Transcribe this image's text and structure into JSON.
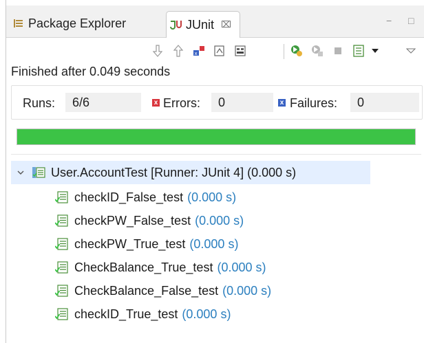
{
  "tabs": [
    {
      "label": "Package Explorer",
      "icon": "package-explorer-icon",
      "active": false
    },
    {
      "label": "JUnit",
      "icon": "junit-icon",
      "active": true,
      "close_glyph": "⌧"
    }
  ],
  "window_controls": {
    "minimize": "−",
    "maximize": "□"
  },
  "toolbar_icons": [
    "next-failure-icon",
    "previous-failure-icon",
    "show-failures-only-icon",
    "scroll-lock-icon",
    "show-skipped-icon",
    "rerun-test-icon",
    "rerun-failed-first-icon",
    "stop-icon",
    "test-run-history-icon",
    "history-dropdown-icon",
    "view-menu-icon"
  ],
  "status": "Finished after 0.049 seconds",
  "counters": {
    "runs_label": "Runs:",
    "runs_value": "6/6",
    "errors_label": "Errors:",
    "errors_value": "0",
    "failures_label": "Failures:",
    "failures_value": "0"
  },
  "progress": {
    "fraction": 1.0,
    "color": "#3cc346"
  },
  "tree": {
    "root": {
      "label": "User.AccountTest [Runner: JUnit 4] (0.000 s)",
      "expanded": true
    },
    "children": [
      {
        "name": "checkID_False_test",
        "time": "(0.000 s)"
      },
      {
        "name": "checkPW_False_test",
        "time": "(0.000 s)"
      },
      {
        "name": "checkPW_True_test",
        "time": "(0.000 s)"
      },
      {
        "name": "CheckBalance_True_test",
        "time": "(0.000 s)"
      },
      {
        "name": "CheckBalance_False_test",
        "time": "(0.000 s)"
      },
      {
        "name": "checkID_True_test",
        "time": "(0.000 s)"
      }
    ]
  },
  "colors": {
    "accent_green": "#3cc346",
    "time_blue": "#2b7fbf",
    "selection": "#e4efff",
    "error_red": "#d9363e",
    "failure_blue": "#3a62c3"
  }
}
